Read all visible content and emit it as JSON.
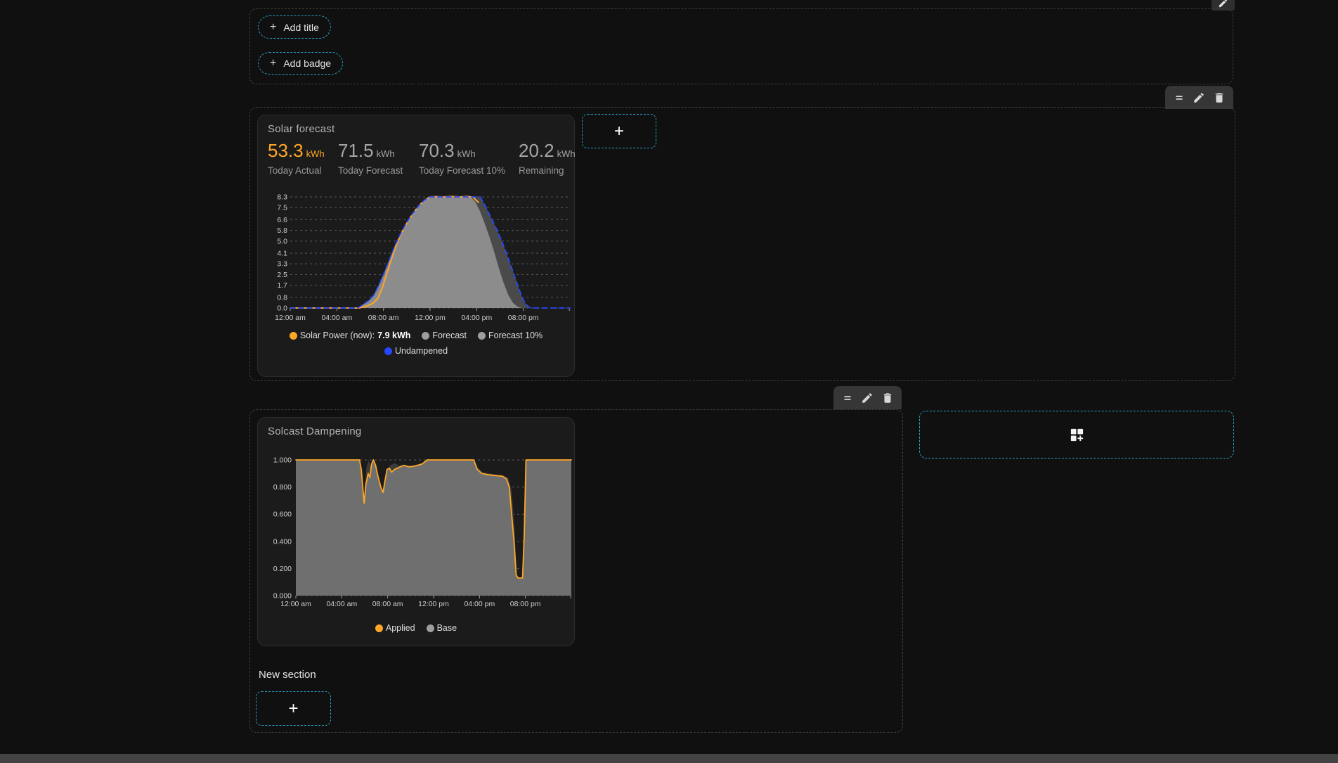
{
  "accents": {
    "cyan": "#2b9fc4",
    "orange": "#ffa726",
    "gray": "#9e9e9e",
    "blue": "#2647ff",
    "bottom_bar": "#434343"
  },
  "icons": {
    "plus": "+",
    "drag_handle": "=",
    "edit": "pencil-icon",
    "delete": "trash-icon",
    "add_section": "grid-plus-icon"
  },
  "top_section": {
    "add_title_label": "Add title",
    "add_badge_label": "Add badge"
  },
  "solar_card": {
    "title": "Solar forecast",
    "stats": [
      {
        "value": "53.3",
        "unit": "kWh",
        "label": "Today Actual"
      },
      {
        "value": "71.5",
        "unit": "kWh",
        "label": "Today Forecast"
      },
      {
        "value": "70.3",
        "unit": "kWh",
        "label": "Today Forecast 10%"
      },
      {
        "value": "20.2",
        "unit": "kWh",
        "label": "Remaining"
      }
    ],
    "legend_rows": [
      [
        {
          "label": "Solar Power (now): ",
          "bold_value": "7.9 kWh",
          "color": "#ffa726"
        },
        {
          "label": "Forecast",
          "color": "#9e9e9e"
        },
        {
          "label": "Forecast 10%",
          "color": "#9e9e9e"
        }
      ],
      [
        {
          "label": "Undampened",
          "color": "#2647ff"
        }
      ]
    ]
  },
  "dampening_card": {
    "title": "Solcast Dampening",
    "legend_rows": [
      [
        {
          "label": "Applied",
          "color": "#ffa726"
        },
        {
          "label": "Base",
          "color": "#9e9e9e"
        }
      ]
    ]
  },
  "new_section": {
    "label": "New section"
  },
  "chart_data": [
    {
      "id": "solar_forecast",
      "type": "area",
      "title": "Solar forecast",
      "grid": "dashed",
      "legend_position": "bottom",
      "x_axis": {
        "unit": "time",
        "range_hours": [
          0,
          24
        ],
        "tick_hours": [
          0,
          4,
          8,
          12,
          16,
          20
        ],
        "tick_labels": [
          "12:00 am",
          "04:00 am",
          "08:00 am",
          "12:00 pm",
          "04:00 pm",
          "08:00 pm"
        ]
      },
      "y_axis": {
        "unit": "kWh",
        "range": [
          0,
          8.3
        ],
        "ticks": [
          0.0,
          0.8,
          1.7,
          2.5,
          3.3,
          4.1,
          5.0,
          5.8,
          6.6,
          7.5,
          8.3
        ],
        "tick_labels": [
          "0.0",
          "0.8",
          "1.7",
          "2.5",
          "3.3",
          "4.1",
          "5.0",
          "5.8",
          "6.6",
          "7.5",
          "8.3"
        ]
      },
      "series": [
        {
          "name": "Forecast 10%",
          "render": "area",
          "color": "#4a4a4a",
          "points": [
            [
              0,
              0
            ],
            [
              5.8,
              0
            ],
            [
              6.3,
              0.3
            ],
            [
              6.8,
              0.6
            ],
            [
              7.2,
              1.0
            ],
            [
              7.6,
              1.7
            ],
            [
              8.0,
              2.5
            ],
            [
              8.5,
              3.6
            ],
            [
              9.0,
              4.7
            ],
            [
              9.5,
              5.6
            ],
            [
              10.0,
              6.4
            ],
            [
              10.5,
              7.05
            ],
            [
              11.0,
              7.6
            ],
            [
              11.5,
              8.05
            ],
            [
              12.0,
              8.3
            ],
            [
              16.3,
              8.3
            ],
            [
              16.75,
              7.6
            ],
            [
              17.2,
              6.8
            ],
            [
              17.65,
              6.0
            ],
            [
              18.1,
              5.1
            ],
            [
              18.55,
              4.1
            ],
            [
              19.0,
              3.0
            ],
            [
              19.4,
              2.0
            ],
            [
              19.8,
              1.0
            ],
            [
              20.15,
              0.35
            ],
            [
              20.5,
              0.05
            ],
            [
              20.7,
              0
            ],
            [
              24,
              0
            ]
          ]
        },
        {
          "name": "Forecast",
          "render": "area",
          "color": "#8c8c8c",
          "points": [
            [
              0,
              0
            ],
            [
              5.8,
              0
            ],
            [
              6.3,
              0.3
            ],
            [
              6.8,
              0.6
            ],
            [
              7.2,
              1.0
            ],
            [
              7.6,
              1.7
            ],
            [
              8.0,
              2.5
            ],
            [
              8.5,
              3.6
            ],
            [
              9.0,
              4.7
            ],
            [
              9.5,
              5.6
            ],
            [
              10.0,
              6.4
            ],
            [
              10.5,
              7.05
            ],
            [
              11.0,
              7.6
            ],
            [
              11.5,
              8.05
            ],
            [
              12.0,
              8.3
            ],
            [
              15.5,
              8.3
            ],
            [
              15.9,
              7.9
            ],
            [
              16.3,
              7.2
            ],
            [
              16.7,
              6.3
            ],
            [
              17.1,
              5.3
            ],
            [
              17.5,
              4.2
            ],
            [
              17.9,
              3.0
            ],
            [
              18.3,
              1.9
            ],
            [
              18.7,
              1.0
            ],
            [
              19.1,
              0.4
            ],
            [
              19.5,
              0.1
            ],
            [
              19.9,
              0
            ],
            [
              24,
              0
            ]
          ]
        },
        {
          "name": "Solar Power (now)",
          "render": "line",
          "color": "#ffa726",
          "width": 2,
          "points": [
            [
              0,
              0
            ],
            [
              5.9,
              0
            ],
            [
              6.6,
              0.15
            ],
            [
              7.1,
              0.35
            ],
            [
              7.5,
              0.7
            ],
            [
              7.9,
              1.5
            ],
            [
              8.3,
              2.6
            ],
            [
              8.7,
              3.7
            ],
            [
              9.1,
              4.7
            ],
            [
              9.6,
              5.7
            ],
            [
              10.1,
              6.5
            ],
            [
              10.6,
              7.15
            ],
            [
              11.1,
              7.7
            ],
            [
              11.6,
              8.1
            ],
            [
              12.0,
              8.3
            ],
            [
              12.5,
              8.32
            ],
            [
              13.2,
              8.3
            ],
            [
              13.8,
              8.33
            ],
            [
              14.6,
              8.3
            ],
            [
              15.2,
              8.33
            ],
            [
              15.7,
              8.28
            ],
            [
              15.95,
              8.05
            ],
            [
              16.15,
              7.9
            ]
          ]
        },
        {
          "name": "Undampened",
          "render": "line",
          "dashed": true,
          "color": "#2647ff",
          "width": 1.8,
          "points": [
            [
              0,
              0
            ],
            [
              5.8,
              0
            ],
            [
              6.3,
              0.3
            ],
            [
              6.8,
              0.6
            ],
            [
              7.2,
              1.0
            ],
            [
              7.6,
              1.7
            ],
            [
              8.0,
              2.5
            ],
            [
              8.5,
              3.6
            ],
            [
              9.0,
              4.7
            ],
            [
              9.5,
              5.6
            ],
            [
              10.0,
              6.4
            ],
            [
              10.5,
              7.05
            ],
            [
              11.0,
              7.6
            ],
            [
              11.5,
              8.05
            ],
            [
              12.0,
              8.3
            ],
            [
              16.3,
              8.3
            ],
            [
              16.75,
              7.6
            ],
            [
              17.2,
              6.8
            ],
            [
              17.65,
              6.0
            ],
            [
              18.1,
              5.1
            ],
            [
              18.55,
              4.1
            ],
            [
              19.0,
              3.0
            ],
            [
              19.4,
              2.0
            ],
            [
              19.8,
              1.0
            ],
            [
              20.15,
              0.35
            ],
            [
              20.5,
              0.05
            ],
            [
              20.7,
              0
            ],
            [
              24,
              0
            ]
          ]
        }
      ]
    },
    {
      "id": "solcast_dampening",
      "type": "area",
      "title": "Solcast Dampening",
      "grid": "dashed",
      "legend_position": "bottom",
      "x_axis": {
        "unit": "time",
        "range_hours": [
          0,
          24
        ],
        "tick_hours": [
          0,
          4,
          8,
          12,
          16,
          20
        ],
        "tick_labels": [
          "12:00 am",
          "04:00 am",
          "08:00 am",
          "12:00 pm",
          "04:00 pm",
          "08:00 pm"
        ]
      },
      "y_axis": {
        "unit": "factor",
        "range": [
          0,
          1
        ],
        "ticks": [
          0.0,
          0.2,
          0.4,
          0.6,
          0.8,
          1.0
        ],
        "tick_labels": [
          "0.000",
          "0.200",
          "0.400",
          "0.600",
          "0.800",
          "1.000"
        ]
      },
      "series": [
        {
          "name": "Base",
          "render": "area",
          "color": "#3a3a3a",
          "points": [
            [
              0,
              1
            ],
            [
              5.55,
              1
            ],
            [
              5.7,
              0.9
            ],
            [
              5.95,
              0.68
            ],
            [
              6.15,
              0.95
            ],
            [
              6.35,
              1.0
            ],
            [
              6.6,
              0.93
            ],
            [
              6.9,
              0.88
            ],
            [
              7.2,
              0.84
            ],
            [
              7.5,
              0.79
            ],
            [
              7.75,
              0.74
            ],
            [
              8.0,
              0.9
            ],
            [
              8.2,
              0.96
            ],
            [
              8.6,
              0.975
            ],
            [
              9.0,
              0.96
            ],
            [
              9.5,
              0.965
            ],
            [
              10.0,
              0.955
            ],
            [
              10.5,
              0.965
            ],
            [
              11.0,
              0.975
            ],
            [
              11.45,
              1.0
            ],
            [
              15.5,
              1.0
            ],
            [
              15.85,
              0.945
            ],
            [
              16.25,
              0.91
            ],
            [
              16.9,
              0.9
            ],
            [
              17.5,
              0.89
            ],
            [
              18.1,
              0.885
            ],
            [
              18.5,
              0.87
            ],
            [
              18.8,
              0.78
            ],
            [
              19.05,
              0.5
            ],
            [
              19.25,
              0.16
            ],
            [
              19.4,
              0.135
            ],
            [
              19.8,
              0.13
            ],
            [
              19.95,
              0.5
            ],
            [
              20.1,
              1.0
            ],
            [
              24,
              1.0
            ]
          ]
        },
        {
          "name": "Applied",
          "render": "area-line",
          "color": "#6f6f6f",
          "stroke": "#ffa726",
          "width": 1.8,
          "points": [
            [
              0,
              1
            ],
            [
              5.55,
              1
            ],
            [
              5.7,
              0.93
            ],
            [
              5.95,
              0.68
            ],
            [
              6.1,
              0.82
            ],
            [
              6.3,
              0.9
            ],
            [
              6.45,
              0.87
            ],
            [
              6.6,
              0.97
            ],
            [
              6.75,
              1.0
            ],
            [
              6.95,
              0.96
            ],
            [
              7.15,
              0.88
            ],
            [
              7.4,
              0.8
            ],
            [
              7.6,
              0.76
            ],
            [
              7.75,
              0.84
            ],
            [
              7.95,
              0.93
            ],
            [
              8.15,
              0.94
            ],
            [
              8.35,
              0.91
            ],
            [
              8.6,
              0.93
            ],
            [
              9.0,
              0.945
            ],
            [
              9.4,
              0.96
            ],
            [
              9.8,
              0.95
            ],
            [
              10.2,
              0.952
            ],
            [
              10.6,
              0.96
            ],
            [
              11.0,
              0.97
            ],
            [
              11.45,
              1.0
            ],
            [
              15.5,
              1.0
            ],
            [
              15.8,
              0.93
            ],
            [
              16.2,
              0.9
            ],
            [
              16.8,
              0.89
            ],
            [
              17.4,
              0.885
            ],
            [
              18.0,
              0.88
            ],
            [
              18.35,
              0.86
            ],
            [
              18.6,
              0.8
            ],
            [
              18.85,
              0.55
            ],
            [
              19.0,
              0.41
            ],
            [
              19.2,
              0.15
            ],
            [
              19.35,
              0.13
            ],
            [
              19.75,
              0.13
            ],
            [
              19.9,
              0.45
            ],
            [
              20.05,
              1.0
            ],
            [
              24,
              1.0
            ]
          ]
        }
      ]
    }
  ]
}
